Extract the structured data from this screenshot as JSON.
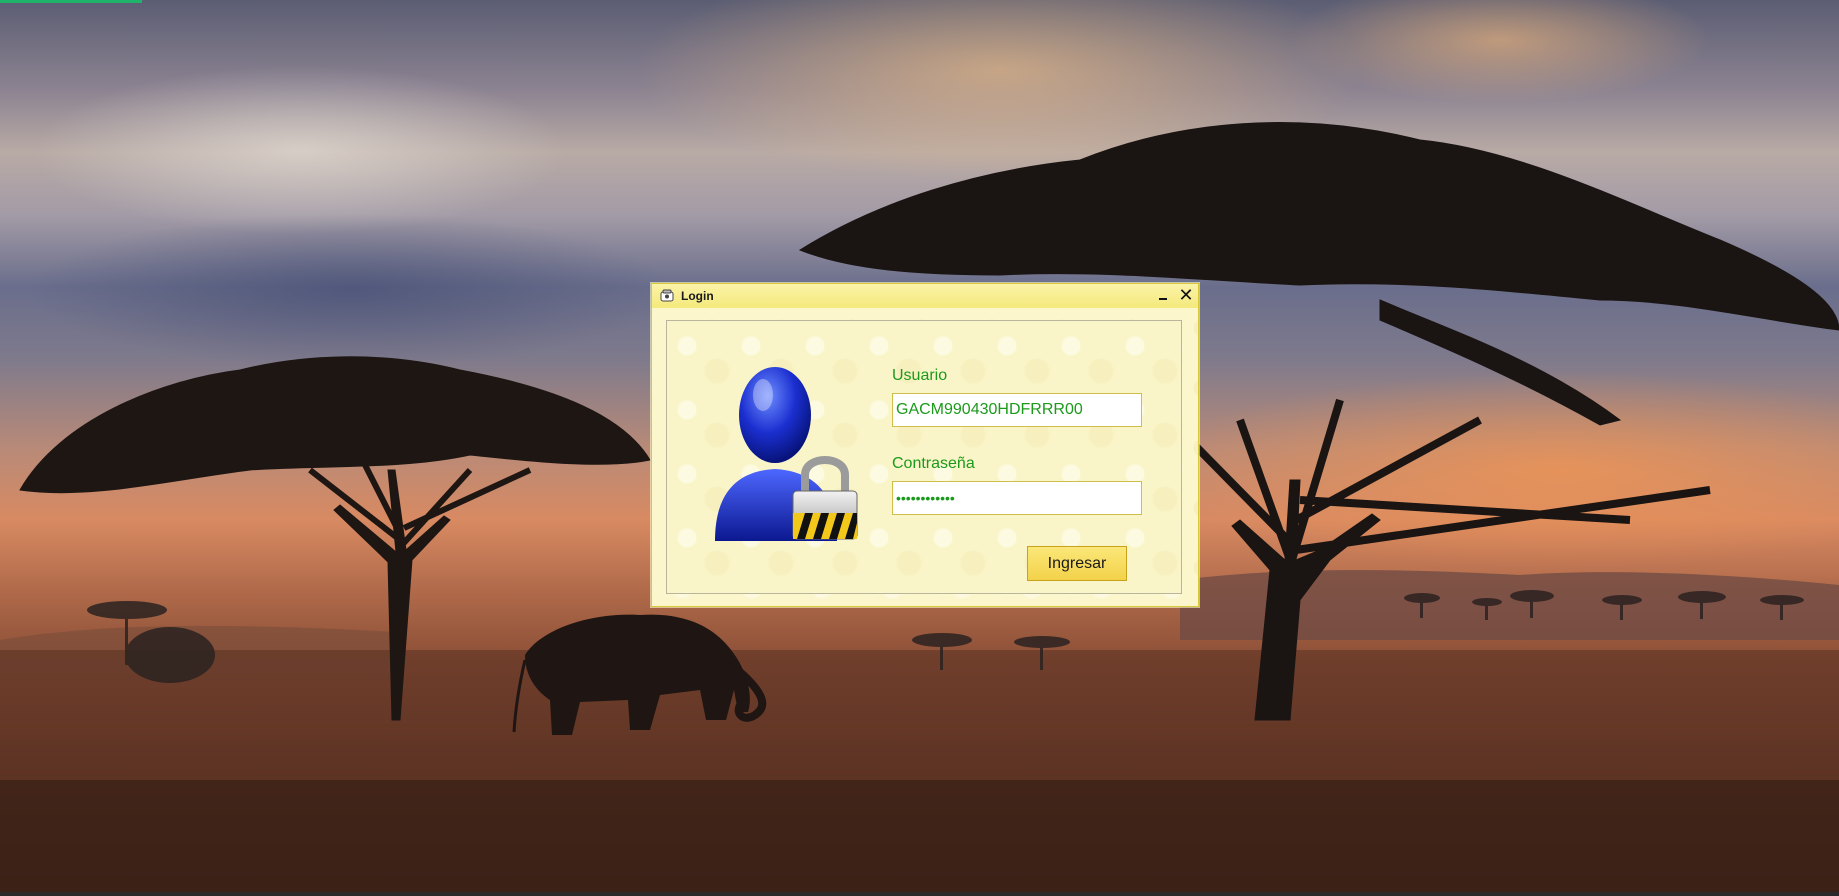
{
  "window": {
    "title": "Login",
    "icon": "login-window-icon"
  },
  "form": {
    "username_label": "Usuario",
    "username_value": "GACM990430HDFRRR00",
    "password_label": "Contraseña",
    "password_masked": "••••••••••••",
    "submit_label": "Ingresar"
  },
  "illustration": "user-lock-icon",
  "colors": {
    "window_background": "#f7ef9a",
    "label_text": "#1b9a1b",
    "button_background": "#f3d24a",
    "taskbar_accent": "#1fb36b"
  }
}
